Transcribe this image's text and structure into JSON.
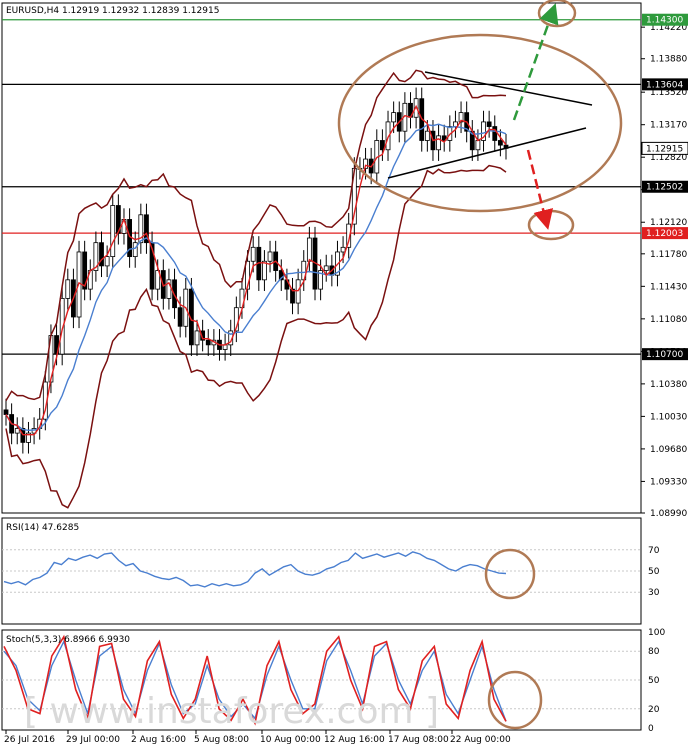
{
  "chart_data": [
    {
      "type": "candlestick",
      "title": "EURUSD,H4  1.12919 1.12932 1.12839 1.12915",
      "symbol": "EURUSD,H4",
      "ohlc_header": "1.12919 1.12932 1.12839 1.12915",
      "ylim": [
        1.0899,
        1.1448
      ],
      "y_ticks": [
        "1.14220",
        "1.13880",
        "1.13520",
        "1.13170",
        "1.12820",
        "1.12470",
        "1.12120",
        "1.11780",
        "1.11430",
        "1.11080",
        "1.10730",
        "1.10380",
        "1.10030",
        "1.09680",
        "1.09330",
        "1.08990"
      ],
      "x_ticks": [
        "26 Jul 2016",
        "29 Jul 00:00",
        "2 Aug 16:00",
        "5 Aug 08:00",
        "10 Aug 00:00",
        "12 Aug 16:00",
        "17 Aug 08:00",
        "22 Aug 00:00"
      ],
      "levels": [
        {
          "label": "1.14300",
          "value": 1.143,
          "color": "#2e9a3c"
        },
        {
          "label": "1.13604",
          "value": 1.13604,
          "color": "#000000"
        },
        {
          "label": "1.12915",
          "value": 1.12915,
          "color": "#000000"
        },
        {
          "label": "1.12502",
          "value": 1.12502,
          "color": "#000000"
        },
        {
          "label": "1.12003",
          "value": 1.12003,
          "color": "#e02020"
        },
        {
          "label": "1.10700",
          "value": 1.107,
          "color": "#000000"
        }
      ],
      "close_series": [
        1.1005,
        1.0985,
        1.099,
        1.0975,
        1.0985,
        1.099,
        1.1,
        1.104,
        1.109,
        1.107,
        1.113,
        1.115,
        1.111,
        1.118,
        1.114,
        1.116,
        1.119,
        1.1165,
        1.1175,
        1.123,
        1.12,
        1.1215,
        1.1175,
        1.119,
        1.122,
        1.119,
        1.114,
        1.116,
        1.113,
        1.115,
        1.112,
        1.11,
        1.114,
        1.108,
        1.1095,
        1.1085,
        1.108,
        1.1085,
        1.1075,
        1.108,
        1.1095,
        1.112,
        1.114,
        1.117,
        1.1185,
        1.115,
        1.117,
        1.118,
        1.116,
        1.115,
        1.114,
        1.1125,
        1.115,
        1.117,
        1.1195,
        1.114,
        1.116,
        1.1165,
        1.1155,
        1.118,
        1.1185,
        1.121,
        1.127,
        1.127,
        1.128,
        1.1265,
        1.13,
        1.129,
        1.132,
        1.133,
        1.131,
        1.134,
        1.1325,
        1.1345,
        1.13,
        1.131,
        1.129,
        1.1305,
        1.13,
        1.1315,
        1.132,
        1.133,
        1.131,
        1.129,
        1.13,
        1.132,
        1.1315,
        1.13,
        1.1295,
        1.12915
      ],
      "indicators": [
        "Bollinger Bands",
        "Moving Average (red)",
        "Moving Average (blue)"
      ],
      "annotations": [
        "symmetrical triangle",
        "target circle 1.14300",
        "target circle 1.12003"
      ]
    },
    {
      "type": "line",
      "title": "RSI(14) 47.6285",
      "name": "RSI(14)",
      "value_label": "47.6285",
      "ylim": [
        0,
        100
      ],
      "y_ticks": [
        "70",
        "50",
        "30"
      ],
      "series": [
        {
          "values": [
            40,
            38,
            40,
            37,
            42,
            44,
            48,
            58,
            56,
            62,
            60,
            63,
            65,
            62,
            66,
            67,
            60,
            55,
            57,
            50,
            48,
            45,
            43,
            42,
            44,
            41,
            36,
            37,
            35,
            38,
            36,
            38,
            36,
            37,
            40,
            48,
            52,
            46,
            50,
            54,
            56,
            50,
            47,
            46,
            48,
            52,
            54,
            58,
            60,
            67,
            62,
            64,
            66,
            63,
            65,
            67,
            64,
            68,
            66,
            62,
            60,
            56,
            52,
            50,
            54,
            56,
            55,
            52,
            50,
            48,
            47.6285
          ]
        }
      ]
    },
    {
      "type": "line",
      "title": "Stoch(5,3,3) 6.8966 6.9930",
      "name": "Stoch(5,3,3)",
      "value_label": "6.8966 6.9930",
      "ylim": [
        0,
        100
      ],
      "y_ticks": [
        "100",
        "80",
        "50",
        "20",
        "0"
      ],
      "series": [
        {
          "values": [
            85,
            60,
            20,
            15,
            75,
            95,
            40,
            10,
            85,
            88,
            30,
            12,
            70,
            90,
            35,
            10,
            30,
            75,
            20,
            8,
            30,
            5,
            65,
            90,
            40,
            15,
            25,
            80,
            95,
            50,
            20,
            85,
            90,
            40,
            20,
            70,
            85,
            25,
            10,
            60,
            90,
            30,
            6.8966
          ]
        },
        {
          "values": [
            80,
            65,
            30,
            18,
            65,
            90,
            50,
            15,
            75,
            85,
            40,
            15,
            60,
            88,
            45,
            15,
            25,
            65,
            30,
            12,
            25,
            10,
            55,
            85,
            50,
            20,
            20,
            70,
            90,
            60,
            25,
            75,
            88,
            50,
            25,
            60,
            80,
            35,
            15,
            50,
            85,
            40,
            6.993
          ]
        }
      ]
    }
  ],
  "watermark": "[ www.instaforex.com ]"
}
